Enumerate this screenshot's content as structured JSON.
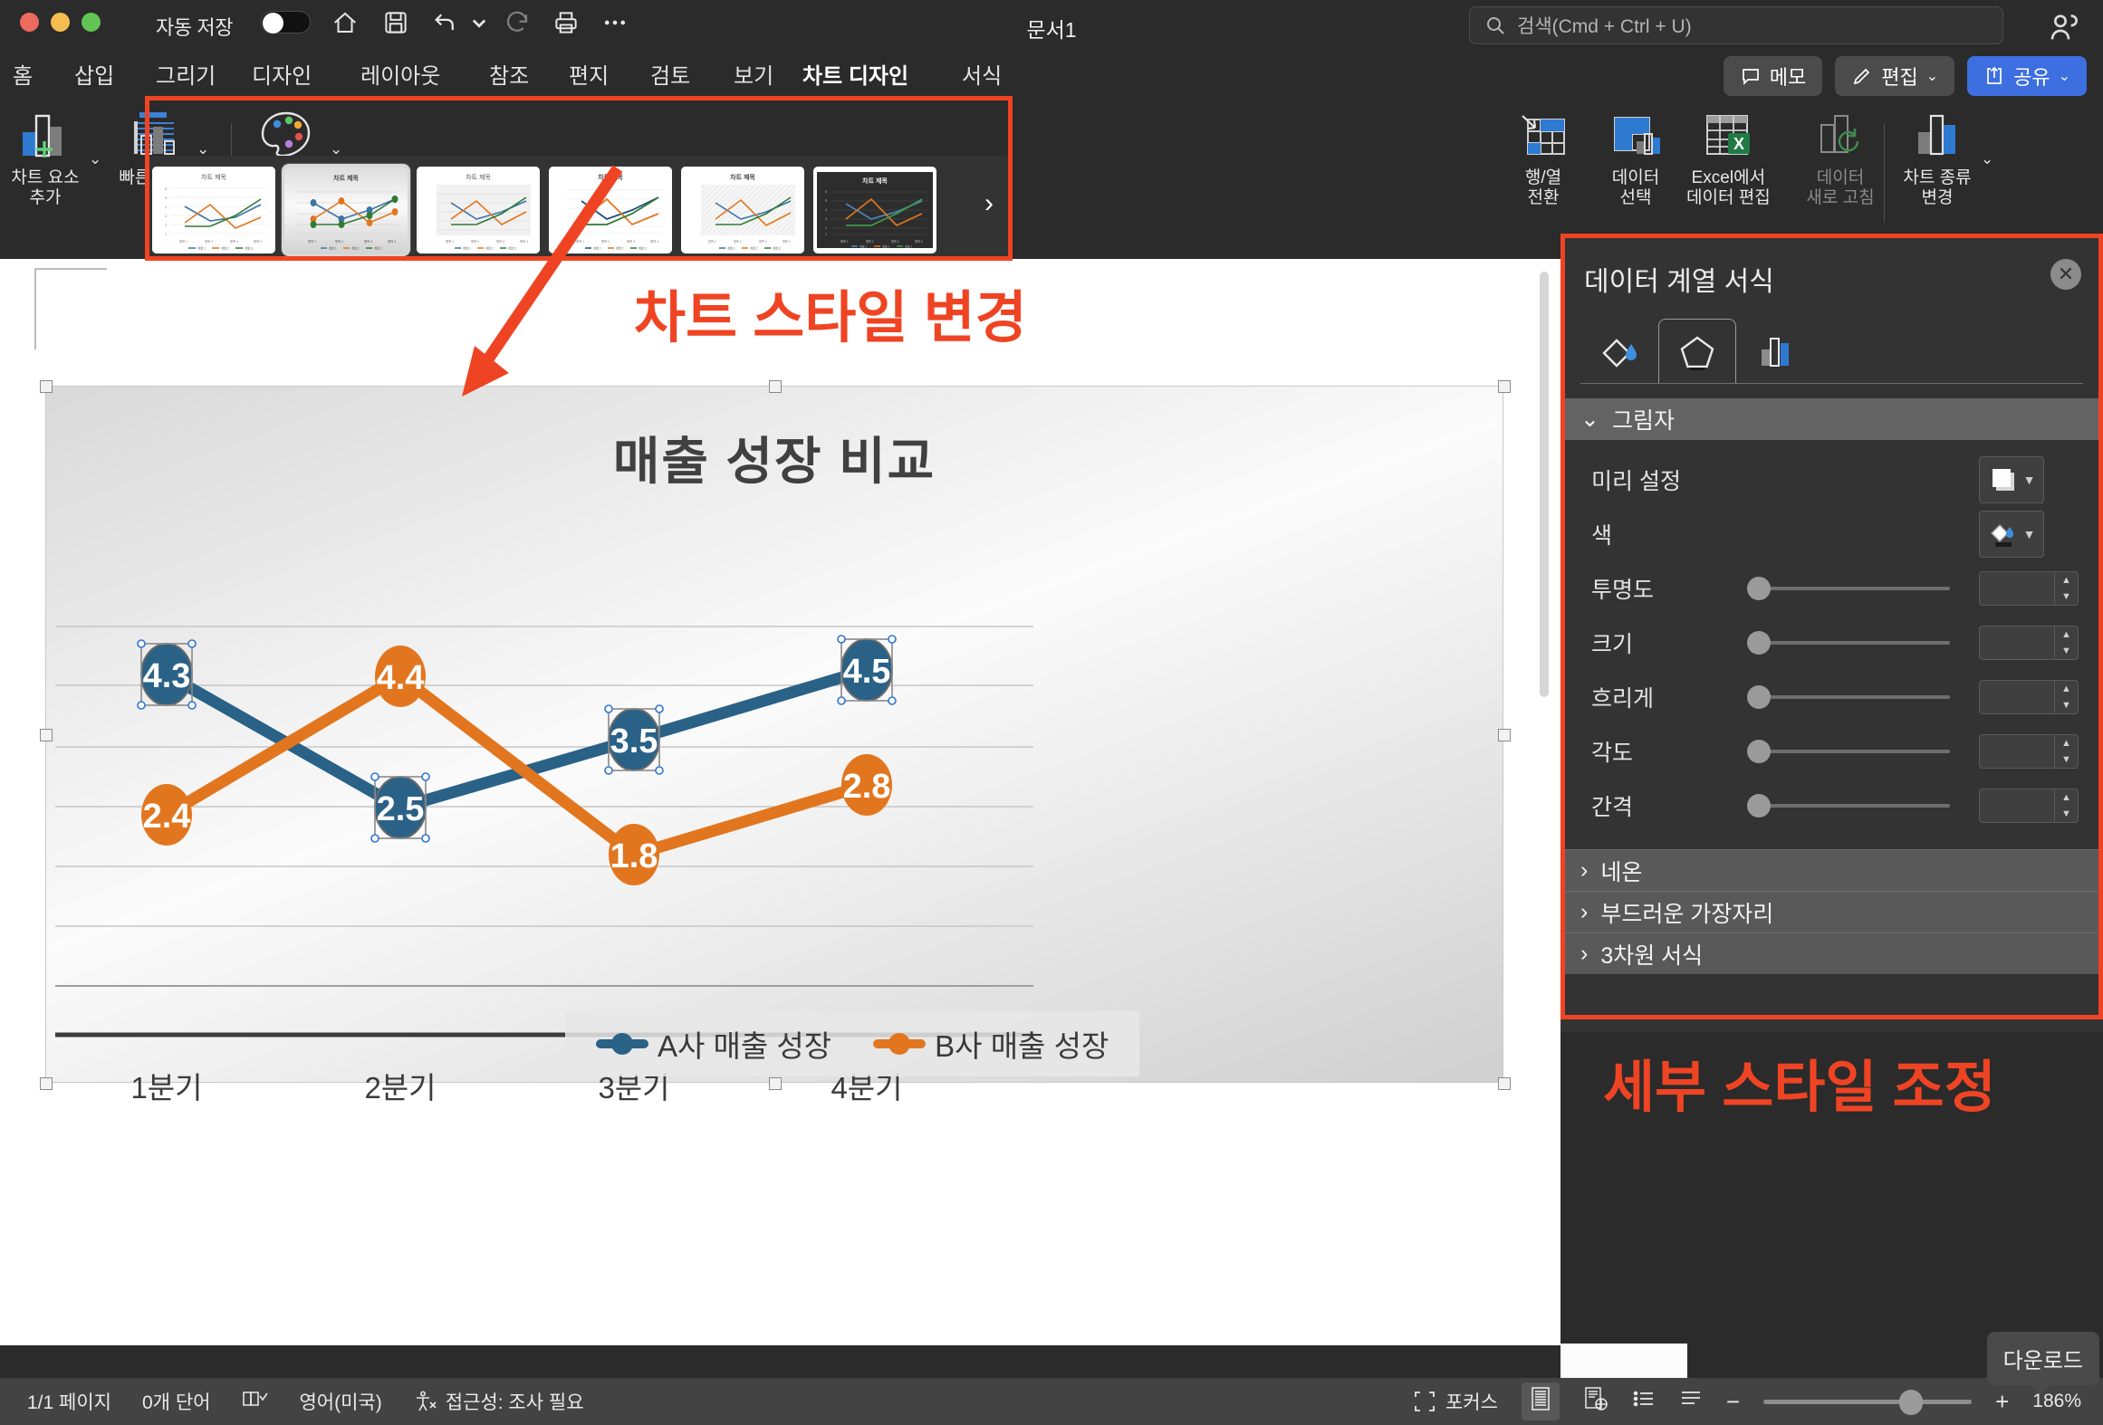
{
  "window": {
    "autosave_label": "자동 저장",
    "autosave_state": "off",
    "document_title": "문서1",
    "search_placeholder": "검색(Cmd + Ctrl + U)",
    "titlebar_icons": [
      "home-icon",
      "save-icon",
      "undo-icon",
      "undo-dropdown-icon",
      "redo-icon",
      "print-icon",
      "more-icon"
    ]
  },
  "menu": {
    "items": [
      {
        "label": "홈",
        "active": false
      },
      {
        "label": "삽입",
        "active": false
      },
      {
        "label": "그리기",
        "active": false
      },
      {
        "label": "디자인",
        "active": false
      },
      {
        "label": "레이아웃",
        "active": false
      },
      {
        "label": "참조",
        "active": false
      },
      {
        "label": "편지",
        "active": false
      },
      {
        "label": "검토",
        "active": false
      },
      {
        "label": "보기",
        "active": false
      },
      {
        "label": "차트 디자인",
        "active": true
      },
      {
        "label": "서식",
        "active": false
      }
    ],
    "memo_label": "메모",
    "edit_label": "편집",
    "share_label": "공유"
  },
  "ribbon": {
    "add_chart_element": "차트 요소\n추가",
    "add_chart_element_l1": "차트 요소",
    "add_chart_element_l2": "추가",
    "quick_layout": "빠른 모양",
    "change_colors": "색 변경",
    "switch_row_col_l1": "행/열",
    "switch_row_col_l2": "전환",
    "select_data_l1": "데이터",
    "select_data_l2": "선택",
    "edit_in_excel_l1": "Excel에서",
    "edit_in_excel_l2": "데이터 편집",
    "refresh_data_l1": "데이터",
    "refresh_data_l2": "새로 고침",
    "change_chart_type_l1": "차트 종류",
    "change_chart_type_l2": "변경",
    "gallery_next": "›",
    "gallery_thumb_title": "차트 제목",
    "gallery_selected_index": 1,
    "gallery_count": 6
  },
  "annotations": [
    {
      "text": "차트 스타일 변경",
      "color": "#ef4423"
    },
    {
      "text": "세부 스타일 조정",
      "color": "#ef4423"
    }
  ],
  "panel": {
    "title": "데이터 계열 서식",
    "close_label": "✕",
    "tabs": [
      {
        "name": "fill-line-tab",
        "icon": "paint-bucket-icon",
        "active": false
      },
      {
        "name": "effects-tab",
        "icon": "pentagon-icon",
        "active": true
      },
      {
        "name": "series-options-tab",
        "icon": "bar-chart-icon",
        "active": false
      }
    ],
    "sections": [
      {
        "label": "그림자",
        "expanded": true
      },
      {
        "label": "네온",
        "expanded": false
      },
      {
        "label": "부드러운 가장자리",
        "expanded": false
      },
      {
        "label": "3차원 서식",
        "expanded": false
      }
    ],
    "shadow_rows": [
      {
        "label": "미리 설정",
        "control": "preset-swatch"
      },
      {
        "label": "색",
        "control": "color-swatch"
      },
      {
        "label": "투명도",
        "control": "slider",
        "value": ""
      },
      {
        "label": "크기",
        "control": "slider",
        "value": ""
      },
      {
        "label": "흐리게",
        "control": "slider",
        "value": ""
      },
      {
        "label": "각도",
        "control": "slider",
        "value": ""
      },
      {
        "label": "간격",
        "control": "slider",
        "value": ""
      }
    ]
  },
  "statusbar": {
    "page": "1/1 페이지",
    "words": "0개 단어",
    "language": "영어(미국)",
    "accessibility": "접근성: 조사 필요",
    "focus": "포커스",
    "zoom": "186%",
    "tooltip": "다운로드",
    "minus": "−",
    "plus": "+"
  },
  "chart_data": {
    "type": "line",
    "title": "매출 성장 비교",
    "categories": [
      "1분기",
      "2분기",
      "3분기",
      "4분기"
    ],
    "series": [
      {
        "name": "A사 매출 성장",
        "values": [
          4.3,
          2.5,
          3.5,
          4.5
        ],
        "color": "#2a6186",
        "selected": true
      },
      {
        "name": "B사 매출 성장",
        "values": [
          2.4,
          4.4,
          1.8,
          2.8
        ],
        "color": "#e2761f",
        "selected": false
      }
    ],
    "ylim": [
      0,
      5.2
    ],
    "grid": true,
    "legend_position": "bottom",
    "data_labels": true,
    "xlabel": "",
    "ylabel": ""
  }
}
